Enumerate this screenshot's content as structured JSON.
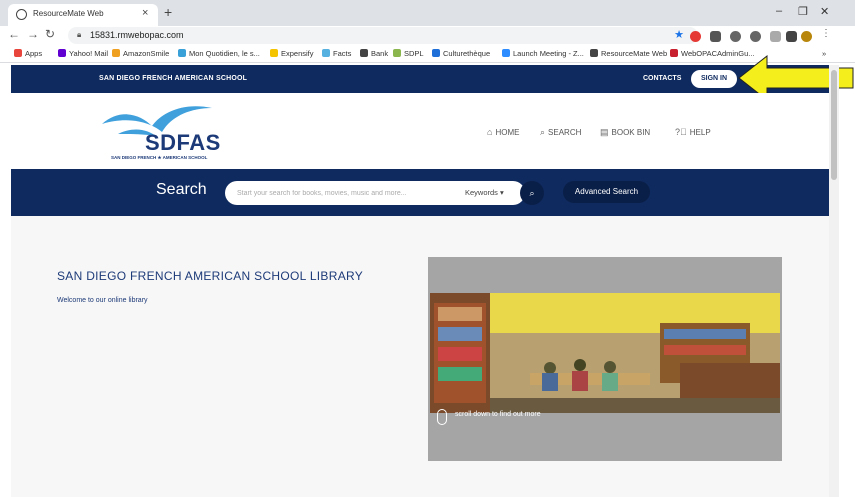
{
  "browser": {
    "tab_title": "ResourceMate Web",
    "tab_close": "×",
    "new_tab": "+",
    "url": "15831.rmwebopac.com",
    "window_controls": [
      "–",
      "❐",
      "✕"
    ],
    "bookmarks": [
      {
        "label": "Apps",
        "color": "#e8453c"
      },
      {
        "label": "Yahoo! Mail",
        "color": "#6001d2"
      },
      {
        "label": "AmazonSmile",
        "color": "#f0a020"
      },
      {
        "label": "Mon Quotidien, le s...",
        "color": "#3aa0d8"
      },
      {
        "label": "Expensify",
        "color": "#f5c400"
      },
      {
        "label": "Facts",
        "color": "#56b0e0"
      },
      {
        "label": "Bank",
        "color": "#444444"
      },
      {
        "label": "SDPL",
        "color": "#8ab64d"
      },
      {
        "label": "Culturethèque",
        "color": "#1f6fd8"
      },
      {
        "label": "Launch Meeting - Z...",
        "color": "#2d8cff"
      },
      {
        "label": "ResourceMate Web",
        "color": "#444444"
      },
      {
        "label": "WebOPACAdminGu...",
        "color": "#c8202f"
      }
    ],
    "bookmarks_more": "»"
  },
  "topbar": {
    "school_name": "SAN DIEGO FRENCH AMERICAN SCHOOL",
    "contacts": "CONTACTS",
    "sign_in": "SIGN IN"
  },
  "logo": {
    "text": "SDFAS",
    "subtitle": "SAN DIEGO FRENCH ★ AMERICAN SCHOOL"
  },
  "nav": [
    {
      "label": "HOME",
      "icon": "home-icon"
    },
    {
      "label": "SEARCH",
      "icon": "search-icon"
    },
    {
      "label": "BOOK BIN",
      "icon": "bookbin-icon"
    },
    {
      "label": "HELP",
      "icon": "help-icon"
    }
  ],
  "search": {
    "title": "Search",
    "placeholder": "Start your search for books, movies, music and more...",
    "keywords": "Keywords",
    "advanced": "Advanced Search"
  },
  "main": {
    "title": "SAN DIEGO FRENCH AMERICAN SCHOOL LIBRARY",
    "subtitle": "Welcome to our online library",
    "scroll_hint": "scroll down to find out more"
  },
  "colors": {
    "navy": "#0f2a5e",
    "arrow": "#f4ef1c"
  }
}
